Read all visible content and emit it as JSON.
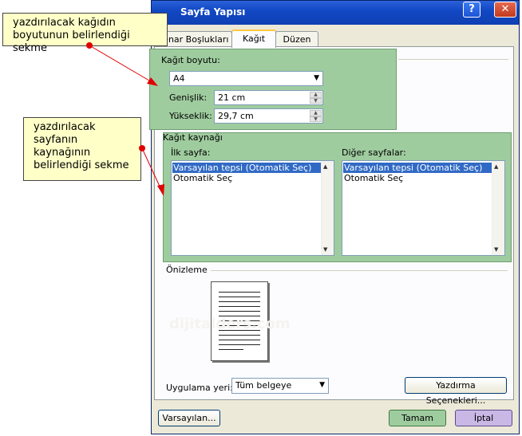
{
  "window": {
    "title": "Sayfa Yapısı",
    "help_label": "?",
    "close_label": "✕"
  },
  "tabs": [
    {
      "label": "Kenar Boşlukları",
      "active": false
    },
    {
      "label": "Kağıt",
      "active": true
    },
    {
      "label": "Düzen",
      "active": false
    }
  ],
  "paper_size": {
    "group_label": "Kağıt boyutu:",
    "selected": "A4",
    "width_label": "Genişlik:",
    "width_value": "21 cm",
    "height_label": "Yükseklik:",
    "height_value": "29,7 cm"
  },
  "paper_source": {
    "group_label": "Kağıt kaynağı",
    "first_page_label": "İlk sayfa:",
    "first_page_items": [
      "Varsayılan tepsi (Otomatik Seç)",
      "Otomatik Seç"
    ],
    "other_pages_label": "Diğer sayfalar:",
    "other_pages_items": [
      "Varsayılan tepsi (Otomatik Seç)",
      "Otomatik Seç"
    ]
  },
  "preview": {
    "label": "Önizleme",
    "watermark": "dijitalders.com"
  },
  "apply_to": {
    "label": "Uygulama yeri:",
    "value": "Tüm belgeye"
  },
  "buttons": {
    "print_options": "Yazdırma Seçenekleri...",
    "default": "Varsayılan...",
    "ok": "Tamam",
    "cancel": "İptal"
  },
  "callouts": {
    "paper_size_note": "yazdırılacak kağıdın boyutunun belirlendiği sekme",
    "paper_source_note": "yazdırılacak sayfanın kaynağının belirlendiği sekme"
  },
  "colors": {
    "highlight_green": "#9fcc9f",
    "callout_yellow": "#ffffc8",
    "arrow_red": "#e00000",
    "titlebar_blue": "#1248c4",
    "selection_blue": "#316ac5"
  }
}
